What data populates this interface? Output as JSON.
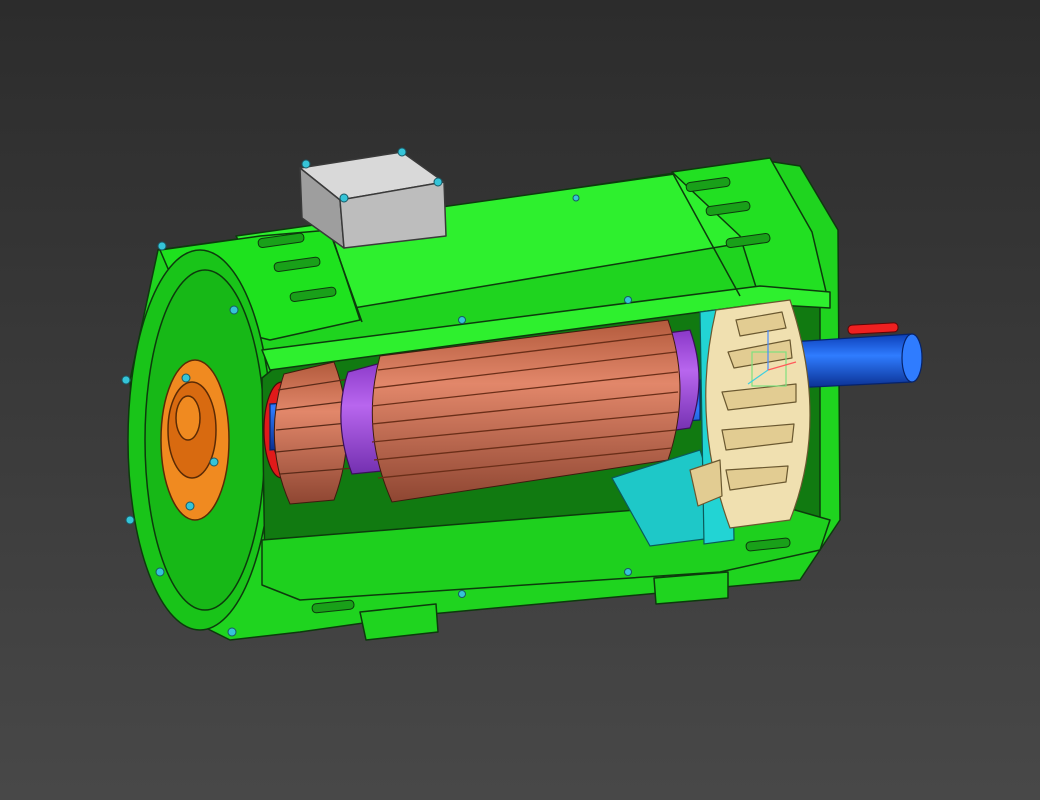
{
  "viewport": {
    "background_top": "#2c2c2c",
    "background_bottom": "#484848"
  },
  "model": {
    "name": "electric-motor-cutaway",
    "parts": [
      {
        "name": "motor-housing",
        "color": "#19e619"
      },
      {
        "name": "terminal-box",
        "color": "#c9c9c9"
      },
      {
        "name": "end-bearing-cap",
        "color": "#ee7a10"
      },
      {
        "name": "commutator",
        "color": "#c8704e"
      },
      {
        "name": "rotor-core",
        "color": "#c86a48"
      },
      {
        "name": "rotor-end-ring",
        "color": "#a84ee0"
      },
      {
        "name": "cooling-fan",
        "color": "#eedcaa"
      },
      {
        "name": "fan-shroud",
        "color": "#1ec8c8"
      },
      {
        "name": "shaft",
        "color": "#1a5fe6"
      },
      {
        "name": "key",
        "color": "#ee2020"
      },
      {
        "name": "bearing-ring",
        "color": "#e01a1a"
      }
    ]
  },
  "icons": {
    "axis_triad": "axis-triad-icon"
  }
}
